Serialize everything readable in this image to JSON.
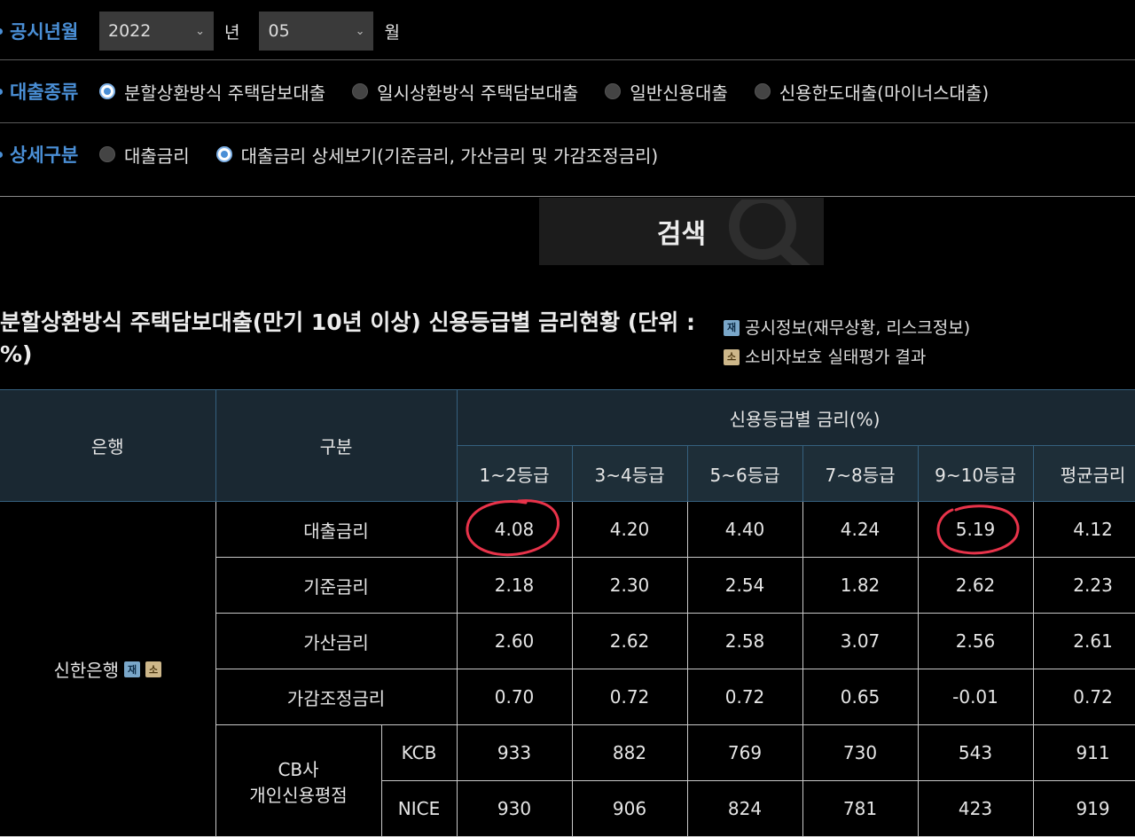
{
  "filters": {
    "period": {
      "label": "공시년월",
      "year": "2022",
      "year_unit": "년",
      "month": "05",
      "month_unit": "월"
    },
    "loan_type": {
      "label": "대출종류",
      "options": [
        {
          "label": "분할상환방식 주택담보대출",
          "selected": true
        },
        {
          "label": "일시상환방식 주택담보대출",
          "selected": false
        },
        {
          "label": "일반신용대출",
          "selected": false
        },
        {
          "label": "신용한도대출(마이너스대출)",
          "selected": false
        }
      ]
    },
    "detail": {
      "label": "상세구분",
      "options": [
        {
          "label": "대출금리",
          "selected": false
        },
        {
          "label": "대출금리 상세보기(기준금리, 가산금리 및 가감조정금리)",
          "selected": true
        }
      ]
    }
  },
  "search": {
    "label": "검색",
    "icon": "magnifier-icon"
  },
  "result": {
    "title": "분할상환방식 주택담보대출(만기 10년 이상) 신용등급별 금리현황 (단위 : %)",
    "links": [
      {
        "tag": "재",
        "label": "공시정보(재무상황, 리스크정보)"
      },
      {
        "tag": "소",
        "label": "소비자보호 실태평가 결과"
      }
    ]
  },
  "table": {
    "headers": {
      "bank": "은행",
      "category": "구분",
      "group": "신용등급별 금리(%)",
      "grades": [
        "1~2등급",
        "3~4등급",
        "5~6등급",
        "7~8등급",
        "9~10등급",
        "평균금리"
      ]
    },
    "bank": {
      "name": "신한은행",
      "tags": [
        "재",
        "소"
      ]
    },
    "rows": [
      {
        "label": "대출금리",
        "values": [
          "4.08",
          "4.20",
          "4.40",
          "4.24",
          "5.19",
          "4.12"
        ]
      },
      {
        "label": "기준금리",
        "values": [
          "2.18",
          "2.30",
          "2.54",
          "1.82",
          "2.62",
          "2.23"
        ]
      },
      {
        "label": "가산금리",
        "values": [
          "2.60",
          "2.62",
          "2.58",
          "3.07",
          "2.56",
          "2.61"
        ]
      },
      {
        "label": "가감조정금리",
        "values": [
          "0.70",
          "0.72",
          "0.72",
          "0.65",
          "-0.01",
          "0.72"
        ]
      }
    ],
    "cb": {
      "label_line1": "CB사",
      "label_line2": "개인신용평점",
      "rows": [
        {
          "label": "KCB",
          "values": [
            "933",
            "882",
            "769",
            "730",
            "543",
            "911"
          ]
        },
        {
          "label": "NICE",
          "values": [
            "930",
            "906",
            "824",
            "781",
            "423",
            "919"
          ]
        }
      ]
    }
  },
  "annotation": {
    "color": "#e8334a"
  }
}
